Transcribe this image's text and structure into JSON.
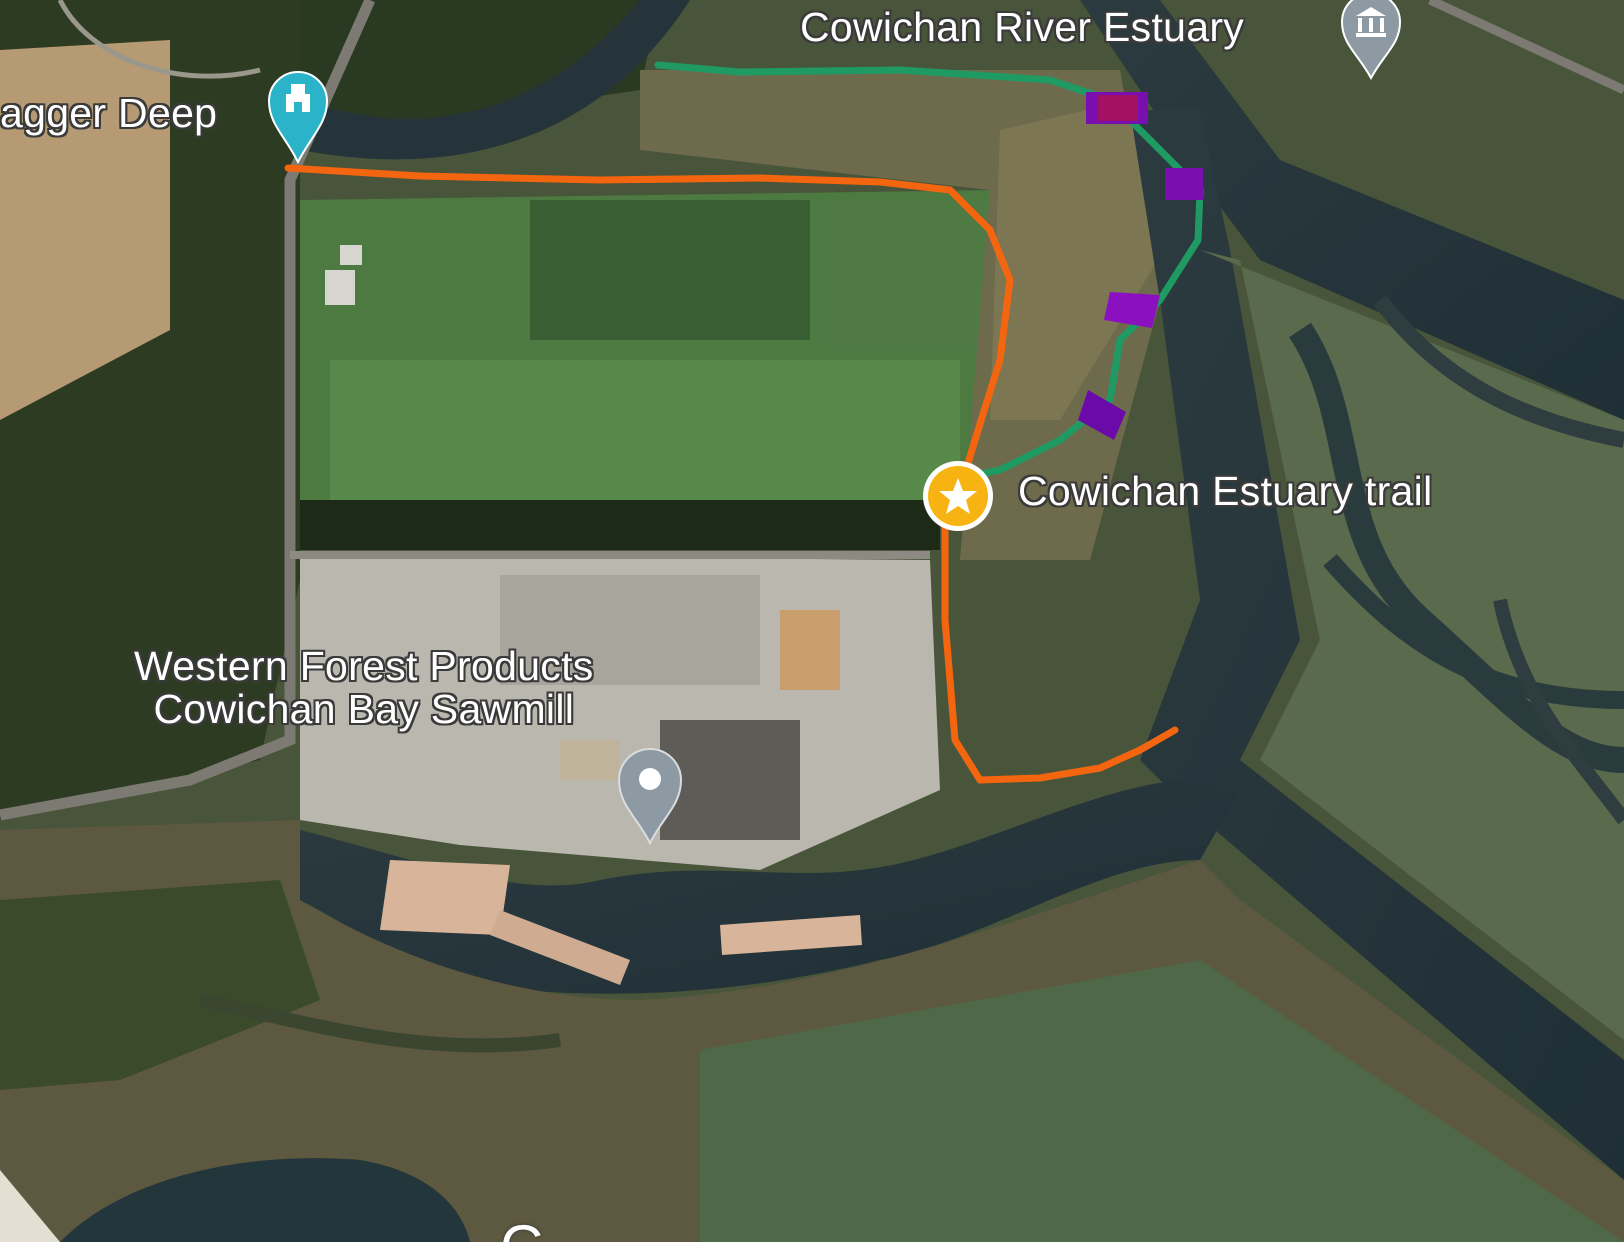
{
  "map": {
    "type": "satellite",
    "labels": {
      "top_left_place": "agger Deep",
      "estuary_place": "Cowichan River Estuary",
      "trail_place": "Cowichan Estuary trail",
      "sawmill_line1": "Western Forest Products",
      "sawmill_line2": "Cowichan Bay Sawmill",
      "bottom_partial": "C"
    },
    "icons": {
      "top_left_place": "historic-site-pin-icon",
      "estuary_place": "museum-pin-icon",
      "trail_place": "trail-star-marker-icon",
      "sawmill": "place-pin-icon"
    },
    "colors": {
      "route_orange": "#f4650f",
      "route_green": "#1f9a63",
      "segment_purple": "#7a0fb0",
      "pin_teal": "#2bb3c9",
      "pin_grey": "#8d99a3",
      "star_marker": "#f6b312"
    }
  }
}
